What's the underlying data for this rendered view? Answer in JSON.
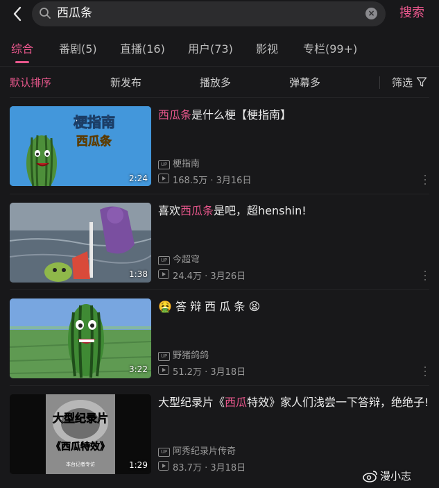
{
  "search": {
    "query": "西瓜条",
    "submit_label": "搜索"
  },
  "tabs": [
    {
      "label": "综合"
    },
    {
      "label": "番剧(5)"
    },
    {
      "label": "直播(16)"
    },
    {
      "label": "用户(73)"
    },
    {
      "label": "影视"
    },
    {
      "label": "专栏(99+)"
    }
  ],
  "sort": {
    "options": [
      {
        "label": "默认排序"
      },
      {
        "label": "新发布"
      },
      {
        "label": "播放多"
      },
      {
        "label": "弹幕多"
      }
    ],
    "filter_label": "筛选"
  },
  "results": [
    {
      "title_parts": [
        {
          "text": "西瓜条",
          "highlight": true
        },
        {
          "text": "是什么梗【梗指南】",
          "highlight": false
        }
      ],
      "uploader": "梗指南",
      "views": "168.5万",
      "date": "3月16日",
      "duration": "2:24",
      "thumb_text": [
        "梗指南",
        "西瓜条"
      ]
    },
    {
      "title_parts": [
        {
          "text": "喜欢",
          "highlight": false
        },
        {
          "text": "西瓜条",
          "highlight": true
        },
        {
          "text": "是吧，超henshin!",
          "highlight": false
        }
      ],
      "uploader": "今超穹",
      "views": "24.4万",
      "date": "3月26日",
      "duration": "1:38",
      "thumb_text": []
    },
    {
      "title_parts": [
        {
          "text": "🤮 答 辩 西 瓜 条 😫",
          "highlight": false
        }
      ],
      "uploader": "野猪鸽鸽",
      "views": "51.2万",
      "date": "3月18日",
      "duration": "3:22",
      "thumb_text": []
    },
    {
      "title_parts": [
        {
          "text": "大型纪录片《",
          "highlight": false
        },
        {
          "text": "西瓜",
          "highlight": true
        },
        {
          "text": "特效》家人们浅尝一下答辩，绝绝子!",
          "highlight": false
        }
      ],
      "uploader": "阿秀纪录片传奇",
      "views": "83.7万",
      "date": "3月18日",
      "duration": "1:29",
      "thumb_text": [
        "大型纪录片",
        "《西瓜特效》",
        "本台记者专访"
      ]
    }
  ],
  "badges": {
    "up": "UP"
  },
  "watermark": "漫小志",
  "colors": {
    "accent": "#e8578c",
    "background": "#18181a"
  }
}
